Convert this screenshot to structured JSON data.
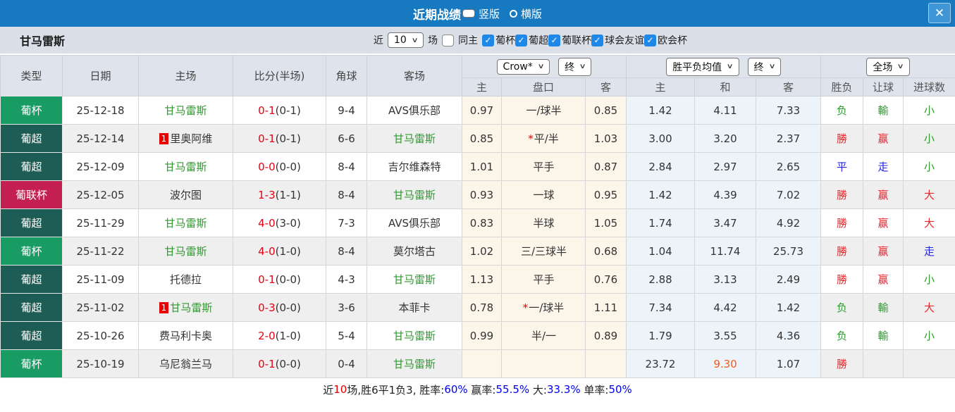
{
  "colors": {
    "titlebar_blue": "#177ac1",
    "close_button_blue": "#4097d7",
    "checkbox_blue": "#1e88e8",
    "league_green": "#199c64",
    "league_teal": "#1e5d55",
    "league_crimson": "#c41f52",
    "win_red": "#e8262d",
    "lose_green": "#2f9a2f",
    "draw_blue": "#2424e0",
    "highlight_orange": "#ef5a1e",
    "score_red": "#e60012",
    "footer_value_blue": "#0000ee"
  },
  "titlebar": {
    "title": "近期战绩",
    "vertical_label": "竖版",
    "horizontal_label": "横版",
    "close_glyph": "✕"
  },
  "filter": {
    "team": "甘马雷斯",
    "near_label": "近",
    "matches_count": "10",
    "matches_label": "场",
    "same_home_label": "同主",
    "leagues": [
      {
        "label": "葡杯",
        "checked": true
      },
      {
        "label": "葡超",
        "checked": true
      },
      {
        "label": "葡联杯",
        "checked": true
      },
      {
        "label": "球会友谊",
        "checked": true
      },
      {
        "label": "欧会杯",
        "checked": true
      }
    ]
  },
  "table": {
    "main_headers": [
      "类型",
      "日期",
      "主场",
      "比分(半场)",
      "角球",
      "客场"
    ],
    "selects": {
      "odds_source": "Crow*",
      "odds_time_1": "终",
      "avg_type": "胜平负均值",
      "odds_time_2": "终",
      "scope": "全场"
    },
    "sub_headers": [
      "主",
      "盘口",
      "客",
      "主",
      "和",
      "客",
      "胜负",
      "让球",
      "进球数"
    ],
    "rows": [
      {
        "league": "葡杯",
        "league_color": "green",
        "date": "25-12-18",
        "home_rank": "",
        "home": "甘马雷斯",
        "home_color": "green",
        "score": "0-1",
        "half": "(0-1)",
        "corner": "9-4",
        "away": "AVS俱乐部",
        "away_color": "dark",
        "hc_home": "0.97",
        "hc_star": "",
        "hc_line": "一/球半",
        "hc_away": "0.85",
        "avg_home": "1.42",
        "avg_draw": "4.11",
        "avg_draw_color": "dark",
        "avg_away": "7.33",
        "result": "负",
        "result_color": "green",
        "hc_result": "輸",
        "hc_result_color": "green",
        "goals": "小",
        "goals_color": "green"
      },
      {
        "league": "葡超",
        "league_color": "teal",
        "date": "25-12-14",
        "home_rank": "1",
        "home": "里奥阿维",
        "home_color": "dark",
        "score": "0-1",
        "half": "(0-1)",
        "corner": "6-6",
        "away": "甘马雷斯",
        "away_color": "green",
        "hc_home": "0.85",
        "hc_star": "*",
        "hc_line": "平/半",
        "hc_away": "1.03",
        "avg_home": "3.00",
        "avg_draw": "3.20",
        "avg_draw_color": "dark",
        "avg_away": "2.37",
        "result": "勝",
        "result_color": "red",
        "hc_result": "赢",
        "hc_result_color": "red",
        "goals": "小",
        "goals_color": "green"
      },
      {
        "league": "葡超",
        "league_color": "teal",
        "date": "25-12-09",
        "home_rank": "",
        "home": "甘马雷斯",
        "home_color": "green",
        "score": "0-0",
        "half": "(0-0)",
        "corner": "8-4",
        "away": "吉尔维森特",
        "away_color": "dark",
        "hc_home": "1.01",
        "hc_star": "",
        "hc_line": "平手",
        "hc_away": "0.87",
        "avg_home": "2.84",
        "avg_draw": "2.97",
        "avg_draw_color": "dark",
        "avg_away": "2.65",
        "result": "平",
        "result_color": "blue",
        "hc_result": "走",
        "hc_result_color": "blue",
        "goals": "小",
        "goals_color": "green"
      },
      {
        "league": "葡联杯",
        "league_color": "crimson",
        "date": "25-12-05",
        "home_rank": "",
        "home": "波尔图",
        "home_color": "dark",
        "score": "1-3",
        "half": "(1-1)",
        "corner": "8-4",
        "away": "甘马雷斯",
        "away_color": "green",
        "hc_home": "0.93",
        "hc_star": "",
        "hc_line": "一球",
        "hc_away": "0.95",
        "avg_home": "1.42",
        "avg_draw": "4.39",
        "avg_draw_color": "dark",
        "avg_away": "7.02",
        "result": "勝",
        "result_color": "red",
        "hc_result": "赢",
        "hc_result_color": "red",
        "goals": "大",
        "goals_color": "red"
      },
      {
        "league": "葡超",
        "league_color": "teal",
        "date": "25-11-29",
        "home_rank": "",
        "home": "甘马雷斯",
        "home_color": "green",
        "score": "4-0",
        "half": "(3-0)",
        "corner": "7-3",
        "away": "AVS俱乐部",
        "away_color": "dark",
        "hc_home": "0.83",
        "hc_star": "",
        "hc_line": "半球",
        "hc_away": "1.05",
        "avg_home": "1.74",
        "avg_draw": "3.47",
        "avg_draw_color": "dark",
        "avg_away": "4.92",
        "result": "勝",
        "result_color": "red",
        "hc_result": "赢",
        "hc_result_color": "red",
        "goals": "大",
        "goals_color": "red"
      },
      {
        "league": "葡杯",
        "league_color": "green",
        "date": "25-11-22",
        "home_rank": "",
        "home": "甘马雷斯",
        "home_color": "green",
        "score": "4-0",
        "half": "(1-0)",
        "corner": "8-4",
        "away": "莫尔塔古",
        "away_color": "dark",
        "hc_home": "1.02",
        "hc_star": "",
        "hc_line": "三/三球半",
        "hc_away": "0.68",
        "avg_home": "1.04",
        "avg_draw": "11.74",
        "avg_draw_color": "dark",
        "avg_away": "25.73",
        "result": "勝",
        "result_color": "red",
        "hc_result": "赢",
        "hc_result_color": "red",
        "goals": "走",
        "goals_color": "blue"
      },
      {
        "league": "葡超",
        "league_color": "teal",
        "date": "25-11-09",
        "home_rank": "",
        "home": "托德拉",
        "home_color": "dark",
        "score": "0-1",
        "half": "(0-0)",
        "corner": "4-3",
        "away": "甘马雷斯",
        "away_color": "green",
        "hc_home": "1.13",
        "hc_star": "",
        "hc_line": "平手",
        "hc_away": "0.76",
        "avg_home": "2.88",
        "avg_draw": "3.13",
        "avg_draw_color": "dark",
        "avg_away": "2.49",
        "result": "勝",
        "result_color": "red",
        "hc_result": "赢",
        "hc_result_color": "red",
        "goals": "小",
        "goals_color": "green"
      },
      {
        "league": "葡超",
        "league_color": "teal",
        "date": "25-11-02",
        "home_rank": "1",
        "home": "甘马雷斯",
        "home_color": "green",
        "score": "0-3",
        "half": "(0-0)",
        "corner": "3-6",
        "away": "本菲卡",
        "away_color": "dark",
        "hc_home": "0.78",
        "hc_star": "*",
        "hc_line": "一/球半",
        "hc_away": "1.11",
        "avg_home": "7.34",
        "avg_draw": "4.42",
        "avg_draw_color": "dark",
        "avg_away": "1.42",
        "result": "负",
        "result_color": "green",
        "hc_result": "輸",
        "hc_result_color": "green",
        "goals": "大",
        "goals_color": "red"
      },
      {
        "league": "葡超",
        "league_color": "teal",
        "date": "25-10-26",
        "home_rank": "",
        "home": "费马利卡奥",
        "home_color": "dark",
        "score": "2-0",
        "half": "(1-0)",
        "corner": "5-4",
        "away": "甘马雷斯",
        "away_color": "green",
        "hc_home": "0.99",
        "hc_star": "",
        "hc_line": "半/一",
        "hc_away": "0.89",
        "avg_home": "1.79",
        "avg_draw": "3.55",
        "avg_draw_color": "dark",
        "avg_away": "4.36",
        "result": "负",
        "result_color": "green",
        "hc_result": "輸",
        "hc_result_color": "green",
        "goals": "小",
        "goals_color": "green"
      },
      {
        "league": "葡杯",
        "league_color": "green",
        "date": "25-10-19",
        "home_rank": "",
        "home": "乌尼翁兰马",
        "home_color": "dark",
        "score": "0-1",
        "half": "(0-0)",
        "corner": "0-4",
        "away": "甘马雷斯",
        "away_color": "green",
        "hc_home": "",
        "hc_star": "",
        "hc_line": "",
        "hc_away": "",
        "avg_home": "23.72",
        "avg_draw": "9.30",
        "avg_draw_color": "orange",
        "avg_away": "1.07",
        "result": "勝",
        "result_color": "red",
        "hc_result": "",
        "hc_result_color": "dark",
        "goals": "",
        "goals_color": "dark"
      }
    ]
  },
  "footer_segments": [
    {
      "text": "近",
      "color": "black"
    },
    {
      "text": "10",
      "color": "red"
    },
    {
      "text": "场,胜6平1负3, 胜率:",
      "color": "black"
    },
    {
      "text": "60%",
      "color": "blue"
    },
    {
      "text": " 赢率:",
      "color": "black"
    },
    {
      "text": "55.5%",
      "color": "blue"
    },
    {
      "text": " 大:",
      "color": "black"
    },
    {
      "text": "33.3%",
      "color": "blue"
    },
    {
      "text": " 单率:",
      "color": "black"
    },
    {
      "text": "50%",
      "color": "blue"
    }
  ]
}
